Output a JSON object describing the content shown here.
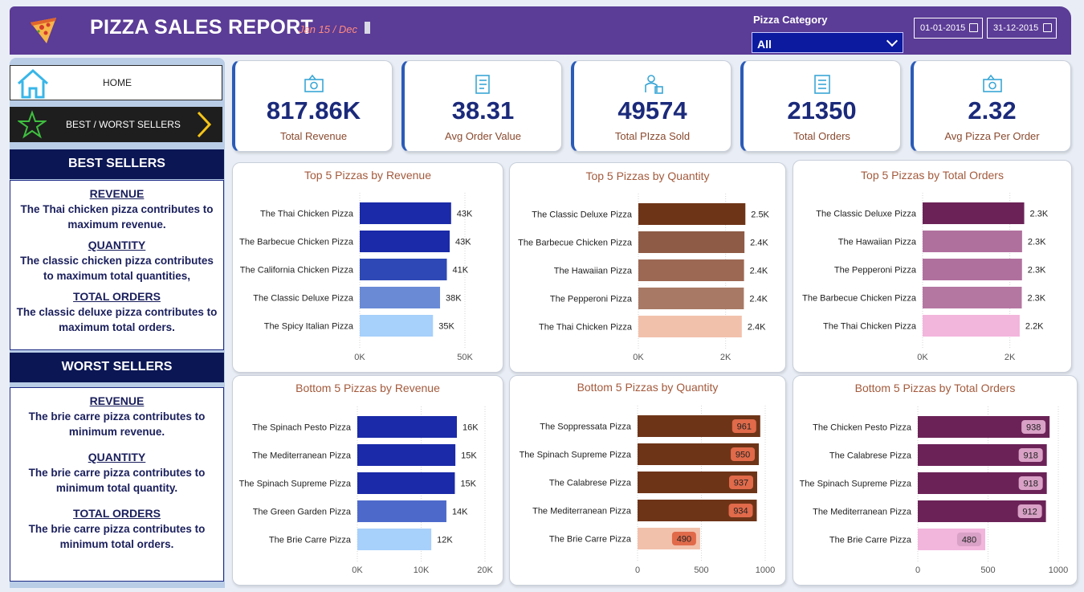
{
  "header": {
    "title": "PIZZA SALES REPORT",
    "date_label": "Jan 15  /  Dec",
    "category_label": "Pizza Category",
    "category_value": "All",
    "date_from": "01-01-2015",
    "date_to": "31-12-2015"
  },
  "nav": {
    "home_label": "HOME",
    "best_worst_label": "BEST / WORST SELLERS"
  },
  "best": {
    "heading": "BEST SELLERS",
    "revenue_title": "REVENUE",
    "revenue_text": "The Thai chicken pizza contributes to maximum revenue.",
    "quantity_title": "QUANTITY",
    "quantity_text": "The classic chicken pizza contributes to maximum total quantities,",
    "orders_title": "TOTAL ORDERS",
    "orders_text": "The classic deluxe pizza contributes to maximum total orders."
  },
  "worst": {
    "heading": "WORST SELLERS",
    "revenue_title": "REVENUE",
    "revenue_text": "The brie carre pizza contributes to minimum revenue.",
    "quantity_title": "QUANTITY",
    "quantity_text": "The brie carre pizza contributes to minimum total quantity.",
    "orders_title": "TOTAL ORDERS",
    "orders_text": "The brie carre pizza contributes to minimum total orders."
  },
  "kpis": [
    {
      "value": "817.86K",
      "label": "Total Revenue",
      "icon": "money-icon"
    },
    {
      "value": "38.31",
      "label": "Avg Order Value",
      "icon": "receipt-icon"
    },
    {
      "value": "49574",
      "label": "Total PIzza Sold",
      "icon": "delivery-icon"
    },
    {
      "value": "21350",
      "label": "Total Orders",
      "icon": "order-list-icon"
    },
    {
      "value": "2.32",
      "label": "Avg Pizza Per Order",
      "icon": "money-icon"
    }
  ],
  "colors": {
    "header": "#5b3c96",
    "blue_dark": "#1a2aa8",
    "brown_dark": "#6e3418",
    "purple_dark": "#6b2357"
  },
  "chart_data": [
    {
      "type": "bar",
      "orientation": "horizontal",
      "title": "Top 5 Pizzas by Revenue",
      "categories": [
        "The Thai Chicken Pizza",
        "The Barbecue Chicken Pizza",
        "The California Chicken Pizza",
        "The Classic Deluxe Pizza",
        "The Spicy Italian Pizza"
      ],
      "values": [
        43434,
        42768,
        41410,
        38181,
        34831
      ],
      "data_labels": [
        "43K",
        "43K",
        "41K",
        "38K",
        "35K"
      ],
      "xlim": [
        0,
        50000
      ],
      "xticks": [
        "0K",
        "50K"
      ],
      "colors": [
        "#1a2aa8",
        "#1a2aa8",
        "#2e49b6",
        "#6a8ad6",
        "#a7d0fb"
      ],
      "label_style": "plain"
    },
    {
      "type": "bar",
      "orientation": "horizontal",
      "title": "Top 5 Pizzas by Quantity",
      "categories": [
        "The Classic Deluxe Pizza",
        "The Barbecue Chicken Pizza",
        "The Hawaiian Pizza",
        "The Pepperoni Pizza",
        "The Thai Chicken Pizza"
      ],
      "values": [
        2453,
        2432,
        2422,
        2418,
        2371
      ],
      "data_labels": [
        "2.5K",
        "2.4K",
        "2.4K",
        "2.4K",
        "2.4K"
      ],
      "xlim": [
        0,
        3000
      ],
      "xticks": [
        "0K",
        "2K"
      ],
      "xtick_values": [
        0,
        2000
      ],
      "colors": [
        "#6e3418",
        "#8e5b46",
        "#9c6853",
        "#a87a65",
        "#f2c1ac"
      ],
      "label_style": "plain"
    },
    {
      "type": "bar",
      "orientation": "horizontal",
      "title": "Top 5 Pizzas by Total Orders",
      "categories": [
        "The Classic Deluxe Pizza",
        "The Hawaiian Pizza",
        "The Pepperoni Pizza",
        "The Barbecue Chicken Pizza",
        "The Thai Chicken Pizza"
      ],
      "values": [
        2329,
        2280,
        2278,
        2273,
        2225
      ],
      "data_labels": [
        "2.3K",
        "2.3K",
        "2.3K",
        "2.3K",
        "2.2K"
      ],
      "xlim": [
        0,
        3000
      ],
      "xticks": [
        "0K",
        "2K"
      ],
      "xtick_values": [
        0,
        2000
      ],
      "colors": [
        "#6b2357",
        "#b0709e",
        "#b0709e",
        "#b477a2",
        "#f2b5dc"
      ],
      "label_style": "plain"
    },
    {
      "type": "bar",
      "orientation": "horizontal",
      "title": "Bottom 5 Pizzas by Revenue",
      "categories": [
        "The Spinach Pesto Pizza",
        "The Mediterranean Pizza",
        "The Spinach Supreme Pizza",
        "The Green Garden Pizza",
        "The Brie Carre Pizza"
      ],
      "values": [
        15596,
        15360,
        15277,
        13955,
        11588
      ],
      "data_labels": [
        "16K",
        "15K",
        "15K",
        "14K",
        "12K"
      ],
      "xlim": [
        0,
        20000
      ],
      "xticks": [
        "0K",
        "10K",
        "20K"
      ],
      "xtick_values": [
        0,
        10000,
        20000
      ],
      "colors": [
        "#1a2aa8",
        "#1a2aa8",
        "#1a2aa8",
        "#4d6acb",
        "#a7d0fb"
      ],
      "label_style": "plain"
    },
    {
      "type": "bar",
      "orientation": "horizontal",
      "title": "Bottom 5 Pizzas by Quantity",
      "categories": [
        "The Soppressata Pizza",
        "The Spinach Supreme Pizza",
        "The Calabrese Pizza",
        "The Mediterranean Pizza",
        "The Brie Carre Pizza"
      ],
      "values": [
        961,
        950,
        937,
        934,
        490
      ],
      "data_labels": [
        "961",
        "950",
        "937",
        "934",
        "490"
      ],
      "xlim": [
        0,
        1000
      ],
      "xticks": [
        "0",
        "500",
        "1000"
      ],
      "xtick_values": [
        0,
        500,
        1000
      ],
      "colors": [
        "#6e3418",
        "#6e3418",
        "#6e3418",
        "#6e3418",
        "#f2c1ac"
      ],
      "label_style": "badge",
      "badge_color": "#e06a4a",
      "badge_text": "#3a1a0e"
    },
    {
      "type": "bar",
      "orientation": "horizontal",
      "title": "Bottom 5 Pizzas by Total Orders",
      "categories": [
        "The Chicken Pesto Pizza",
        "The Calabrese Pizza",
        "The Spinach Supreme Pizza",
        "The Mediterranean Pizza",
        "The Brie Carre Pizza"
      ],
      "values": [
        938,
        918,
        918,
        912,
        480
      ],
      "data_labels": [
        "938",
        "918",
        "918",
        "912",
        "480"
      ],
      "xlim": [
        0,
        1000
      ],
      "xticks": [
        "0",
        "500",
        "1000"
      ],
      "xtick_values": [
        0,
        500,
        1000
      ],
      "colors": [
        "#6b2357",
        "#6b2357",
        "#6b2357",
        "#6b2357",
        "#f2b5dc"
      ],
      "label_style": "badge",
      "badge_color": "#d9a1c6",
      "badge_text": "#3a1030"
    }
  ]
}
